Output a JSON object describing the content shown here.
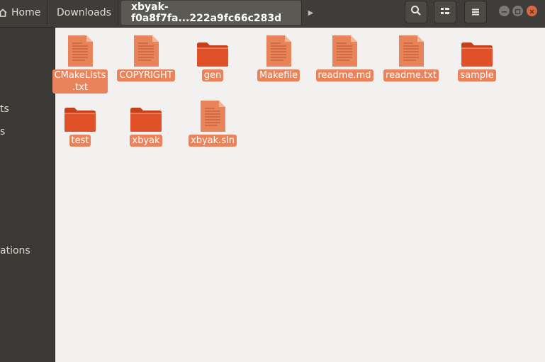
{
  "breadcrumb": {
    "home": "Home",
    "downloads": "Downloads",
    "current": "xbyak-f0a8f7fa...222a9fc66c283d"
  },
  "toolbar": {
    "search_icon": "search-icon",
    "view_icon": "view-options-icon",
    "menu_icon": "hamburger-menu-icon"
  },
  "sidebar": {
    "labels": [
      "ts",
      "s",
      "ations"
    ]
  },
  "files": [
    {
      "name": "CMakeLists\n.txt",
      "kind": "document"
    },
    {
      "name": "COPYRIGHT",
      "kind": "document"
    },
    {
      "name": "gen",
      "kind": "folder"
    },
    {
      "name": "Makefile",
      "kind": "document"
    },
    {
      "name": "readme.md",
      "kind": "document"
    },
    {
      "name": "readme.txt",
      "kind": "document"
    },
    {
      "name": "sample",
      "kind": "folder"
    },
    {
      "name": "test",
      "kind": "folder"
    },
    {
      "name": "xbyak",
      "kind": "folder"
    },
    {
      "name": "xbyak.sln",
      "kind": "document"
    }
  ],
  "colors": {
    "accent": "#e9835b",
    "folder": "#e0512a",
    "document": "#e8845a",
    "header": "#3e3d39"
  }
}
